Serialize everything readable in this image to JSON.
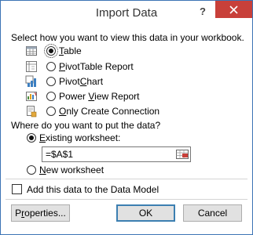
{
  "window": {
    "title": "Import Data",
    "help_label": "?",
    "accent_color": "#c8403a"
  },
  "view_section": {
    "label": "Select how you want to view this data in your workbook.",
    "options": [
      {
        "prefix": "",
        "access": "T",
        "rest": "able",
        "selected": true,
        "icon": "table-icon"
      },
      {
        "prefix": "",
        "access": "P",
        "rest": "ivotTable Report",
        "selected": false,
        "icon": "pivottable-icon"
      },
      {
        "prefix": "Pivot",
        "access": "C",
        "rest": "hart",
        "selected": false,
        "icon": "pivotchart-icon"
      },
      {
        "prefix": "Power ",
        "access": "V",
        "rest": "iew Report",
        "selected": false,
        "icon": "power-view-icon"
      },
      {
        "prefix": "",
        "access": "O",
        "rest": "nly Create Connection",
        "selected": false,
        "icon": "connection-icon"
      }
    ]
  },
  "destination_section": {
    "label": "Where do you want to put the data?",
    "existing_access": "E",
    "existing_rest": "xisting worksheet:",
    "existing_selected": true,
    "address_value": "=$A$1",
    "new_access": "N",
    "new_rest": "ew worksheet",
    "new_selected": false
  },
  "data_model": {
    "label": "Add this data to the Data Model",
    "checked": false
  },
  "buttons": {
    "properties_access": "r",
    "properties_pre": "P",
    "properties_rest": "operties...",
    "ok": "OK",
    "cancel": "Cancel"
  }
}
